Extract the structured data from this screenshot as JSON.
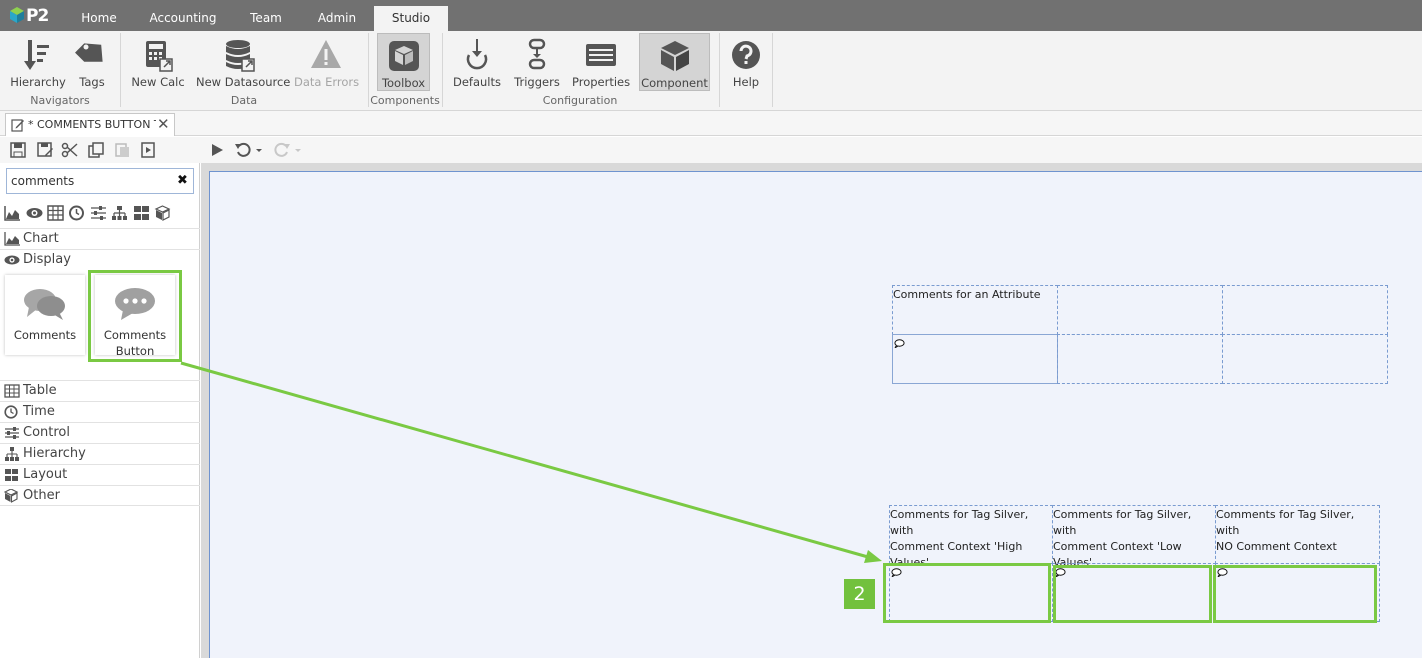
{
  "nav": {
    "logo": "P2",
    "tabs": [
      {
        "label": "Home"
      },
      {
        "label": "Accounting"
      },
      {
        "label": "Team"
      },
      {
        "label": "Admin"
      },
      {
        "label": "Studio",
        "active": true
      }
    ]
  },
  "ribbon": {
    "groups": {
      "navigators": "Navigators",
      "data": "Data",
      "components": "Components",
      "configuration": "Configuration"
    },
    "buttons": {
      "hierarchy": "Hierarchy",
      "tags": "Tags",
      "new_calc": "New Calc",
      "new_datasource": "New Datasource",
      "data_errors": "Data Errors",
      "toolbox": "Toolbox",
      "defaults": "Defaults",
      "triggers": "Triggers",
      "properties": "Properties",
      "component": "Component",
      "help": "Help"
    }
  },
  "document_tab": {
    "label": "* COMMENTS BUTTON TUTORIAL"
  },
  "toolbox": {
    "search_value": "comments",
    "categories": {
      "chart": "Chart",
      "display": "Display",
      "table": "Table",
      "time": "Time",
      "control": "Control",
      "hierarchy": "Hierarchy",
      "layout": "Layout",
      "other": "Other"
    },
    "items": {
      "comments": "Comments",
      "comments_button_line1": "Comments",
      "comments_button_line2": "Button"
    }
  },
  "canvas": {
    "attribute_label": "Comments for an Attribute",
    "tag_high_line1": "Comments for Tag Silver, with",
    "tag_high_line2": "Comment Context 'High Values'",
    "tag_low_line1": "Comments for Tag Silver, with",
    "tag_low_line2": "Comment Context 'Low Values'",
    "tag_none_line1": "Comments for Tag Silver, with",
    "tag_none_line2": "NO Comment Context"
  },
  "annotation": {
    "step_number": "2",
    "accent_color": "#7ac943"
  },
  "colors": {
    "topbar": "#717171",
    "ribbon": "#f3f3f3",
    "canvas": "#f0f3fb",
    "grid_border": "#7a9bd0"
  }
}
